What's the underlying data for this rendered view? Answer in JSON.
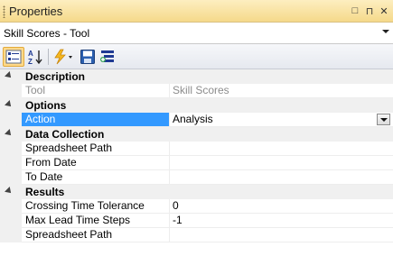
{
  "window": {
    "title": "Properties",
    "buttons": {
      "dock_glyph": "□",
      "pin_glyph": "⊓",
      "close_glyph": "✕"
    }
  },
  "object_selector": {
    "value": "Skill Scores - Tool"
  },
  "toolbar": {
    "icons": [
      "categorized-icon",
      "alphabetical-icon",
      "events-icon",
      "save-icon",
      "property-pages-icon"
    ]
  },
  "grid": {
    "categories": [
      {
        "label": "Description",
        "properties": [
          {
            "name": "Tool",
            "value": "Skill Scores",
            "disabled": true
          }
        ]
      },
      {
        "label": "Options",
        "properties": [
          {
            "name": "Action",
            "value": "Analysis",
            "selected": true,
            "dropdown": true
          }
        ]
      },
      {
        "label": "Data Collection",
        "properties": [
          {
            "name": "Spreadsheet Path",
            "value": ""
          },
          {
            "name": "From Date",
            "value": ""
          },
          {
            "name": "To Date",
            "value": ""
          }
        ]
      },
      {
        "label": "Results",
        "properties": [
          {
            "name": "Crossing Time Tolerance",
            "value": "0"
          },
          {
            "name": "Max Lead Time Steps",
            "value": "-1"
          },
          {
            "name": "Spreadsheet Path",
            "value": ""
          }
        ]
      }
    ]
  },
  "colors": {
    "title_bg": "#f9e4a6",
    "selection": "#3399ff",
    "category_bg": "#f0f0f0"
  }
}
